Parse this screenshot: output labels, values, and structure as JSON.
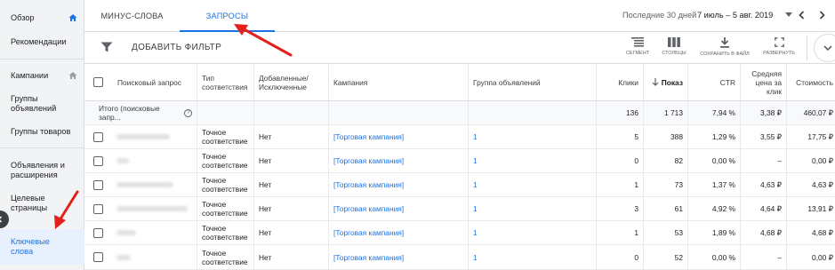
{
  "sidebar": {
    "items": [
      {
        "label": "Обзор",
        "home": true
      },
      {
        "label": "Рекомендации",
        "home": false
      },
      {
        "label": "Кампании",
        "home": true
      },
      {
        "label": "Группы объявлений",
        "home": false
      },
      {
        "label": "Группы товаров",
        "home": false
      },
      {
        "label": "Объявления и расширения",
        "home": false
      },
      {
        "label": "Целевые страницы",
        "home": false
      },
      {
        "label": "Ключевые слова",
        "home": false
      }
    ]
  },
  "tabs": {
    "negative": "МИНУС-СЛОВА",
    "queries": "ЗАПРОСЫ"
  },
  "date": {
    "label": "Последние 30 дней",
    "range": "7 июль – 5 авг. 2019"
  },
  "toolbar": {
    "add_filter": "ДОБАВИТЬ ФИЛЬТР",
    "segment": "СЕГМЕНТ",
    "columns": "СТОЛБЦЫ",
    "download": "СОХРАНИТЬ В ФАЙЛ",
    "expand": "РАЗВЕРНУТЬ"
  },
  "table": {
    "headers": {
      "query": "Поисковый запрос",
      "match_type": "Тип соответствия",
      "added": "Добавленные/ Исключенные",
      "campaign": "Кампания",
      "ad_group": "Группа объявлений",
      "clicks": "Клики",
      "impressions": "Показ",
      "ctr": "CTR",
      "avg_cpc": "Средняя цена за клик",
      "cost": "Стоимость"
    },
    "total": {
      "label": "Итого (поисковые запр...",
      "clicks": "136",
      "impressions": "1 713",
      "ctr": "7,94 %",
      "avg_cpc": "3,38 ₽",
      "cost": "460,07 ₽"
    },
    "rows": [
      {
        "match_type": "Точное соответствие",
        "added": "Нет",
        "campaign": "[Торговая кампания]",
        "ad_group": "1",
        "clicks": "5",
        "impressions": "388",
        "ctr": "1,29 %",
        "avg_cpc": "3,55 ₽",
        "cost": "17,75 ₽"
      },
      {
        "match_type": "Точное соответствие",
        "added": "Нет",
        "campaign": "[Торговая кампания]",
        "ad_group": "1",
        "clicks": "0",
        "impressions": "82",
        "ctr": "0,00 %",
        "avg_cpc": "–",
        "cost": "0,00 ₽"
      },
      {
        "match_type": "Точное соответствие",
        "added": "Нет",
        "campaign": "[Торговая кампания]",
        "ad_group": "1",
        "clicks": "1",
        "impressions": "73",
        "ctr": "1,37 %",
        "avg_cpc": "4,63 ₽",
        "cost": "4,63 ₽"
      },
      {
        "match_type": "Точное соответствие",
        "added": "Нет",
        "campaign": "[Торговая кампания]",
        "ad_group": "1",
        "clicks": "3",
        "impressions": "61",
        "ctr": "4,92 %",
        "avg_cpc": "4,64 ₽",
        "cost": "13,91 ₽"
      },
      {
        "match_type": "Точное соответствие",
        "added": "Нет",
        "campaign": "[Торговая кампания]",
        "ad_group": "1",
        "clicks": "1",
        "impressions": "53",
        "ctr": "1,89 %",
        "avg_cpc": "4,68 ₽",
        "cost": "4,68 ₽"
      },
      {
        "match_type": "Точное соответствие",
        "added": "Нет",
        "campaign": "[Торговая кампания]",
        "ad_group": "1",
        "clicks": "0",
        "impressions": "52",
        "ctr": "0,00 %",
        "avg_cpc": "–",
        "cost": "0,00 ₽"
      }
    ]
  },
  "colors": {
    "accent": "#1a73e8",
    "annotation": "#e3201b",
    "sidebar_bg": "#f1f3f4",
    "active_bg": "#e8f0fe"
  }
}
